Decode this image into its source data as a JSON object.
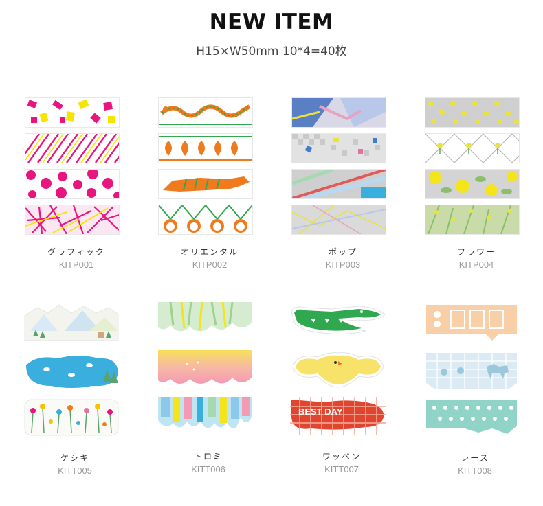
{
  "header": {
    "title": "NEW ITEM",
    "subtitle": "H15×W50mm  10*4=40枚"
  },
  "products": [
    {
      "name": "グラフィック",
      "code": "KITP001"
    },
    {
      "name": "オリエンタル",
      "code": "KITP002"
    },
    {
      "name": "ポップ",
      "code": "KITP003"
    },
    {
      "name": "フラワー",
      "code": "KITP004"
    },
    {
      "name": "ケシキ",
      "code": "KITT005"
    },
    {
      "name": "トロミ",
      "code": "KITT006"
    },
    {
      "name": "ワッペン",
      "code": "KITT007"
    },
    {
      "name": "レース",
      "code": "KITT008"
    }
  ],
  "sticker_text": {
    "best_day": "BEST DAY"
  },
  "colors": {
    "magenta": "#e8157f",
    "yellow": "#f5e500",
    "orange": "#f07a1e",
    "green": "#2fa84f",
    "sky": "#3aaedc",
    "peach": "#f9cfa8",
    "mint": "#8fd4c6",
    "red_check": "#e0452f"
  }
}
